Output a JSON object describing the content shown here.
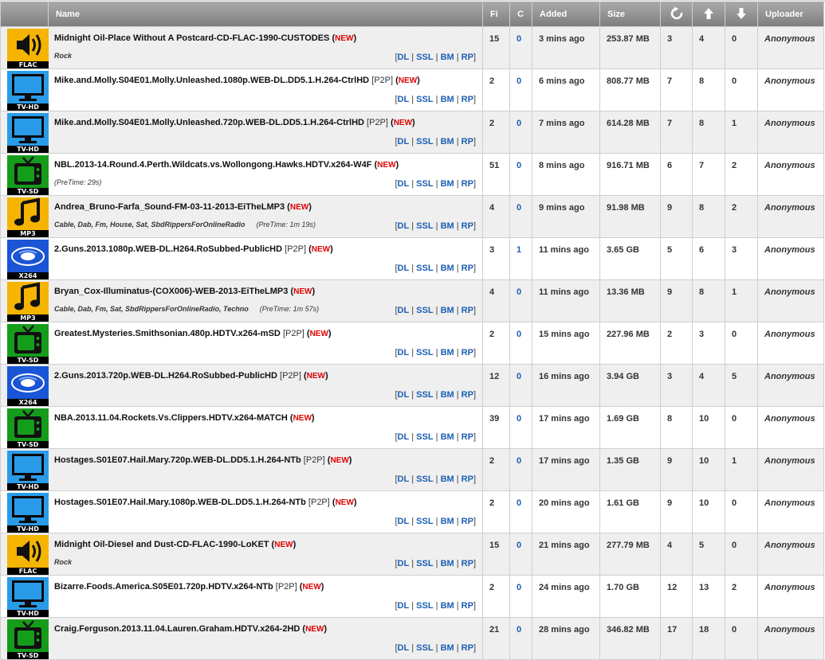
{
  "headers": {
    "name": "Name",
    "files": "Fi",
    "comments": "C",
    "added": "Added",
    "size": "Size",
    "uploader": "Uploader"
  },
  "category_icons": {
    "FLAC": "speaker-icon",
    "TV-HD": "monitor-icon",
    "TV-SD": "television-icon",
    "MP3": "music-note-icon",
    "X264": "bluray-disc-icon"
  },
  "link_labels": [
    "DL",
    "SSL",
    "BM",
    "RP"
  ],
  "new_label": "NEW",
  "torrents": [
    {
      "cat": "FLAC",
      "name": "Midnight Oil-Place Without A Postcard-CD-FLAC-1990-CUSTODES",
      "p2p": "",
      "tags": "Rock",
      "pretime": "",
      "files": "15",
      "comments": "0",
      "added": "3 mins ago",
      "size": "253.87 MB",
      "seeders": "3",
      "up": "4",
      "down": "0",
      "uploader": "Anonymous"
    },
    {
      "cat": "TV-HD",
      "name": "Mike.and.Molly.S04E01.Molly.Unleashed.1080p.WEB-DL.DD5.1.H.264-CtrlHD",
      "p2p": "[P2P]",
      "tags": "",
      "pretime": "",
      "files": "2",
      "comments": "0",
      "added": "6 mins ago",
      "size": "808.77 MB",
      "seeders": "7",
      "up": "8",
      "down": "0",
      "uploader": "Anonymous"
    },
    {
      "cat": "TV-HD",
      "name": "Mike.and.Molly.S04E01.Molly.Unleashed.720p.WEB-DL.DD5.1.H.264-CtrlHD",
      "p2p": "[P2P]",
      "tags": "",
      "pretime": "",
      "files": "2",
      "comments": "0",
      "added": "7 mins ago",
      "size": "614.28 MB",
      "seeders": "7",
      "up": "8",
      "down": "1",
      "uploader": "Anonymous"
    },
    {
      "cat": "TV-SD",
      "name": "NBL.2013-14.Round.4.Perth.Wildcats.vs.Wollongong.Hawks.HDTV.x264-W4F",
      "p2p": "",
      "tags": "",
      "pretime": "(PreTime: 29s)",
      "files": "51",
      "comments": "0",
      "added": "8 mins ago",
      "size": "916.71 MB",
      "seeders": "6",
      "up": "7",
      "down": "2",
      "uploader": "Anonymous"
    },
    {
      "cat": "MP3",
      "name": "Andrea_Bruno-Farfa_Sound-FM-03-11-2013-EiTheLMP3",
      "p2p": "",
      "tags": "Cable, Dab, Fm, House, Sat, SbdRippersForOnlineRadio",
      "pretime": "(PreTime: 1m 19s)",
      "files": "4",
      "comments": "0",
      "added": "9 mins ago",
      "size": "91.98 MB",
      "seeders": "9",
      "up": "8",
      "down": "2",
      "uploader": "Anonymous"
    },
    {
      "cat": "X264",
      "name": "2.Guns.2013.1080p.WEB-DL.H264.RoSubbed-PublicHD",
      "p2p": "[P2P]",
      "tags": "",
      "pretime": "",
      "files": "3",
      "comments": "1",
      "added": "11 mins ago",
      "size": "3.65 GB",
      "seeders": "5",
      "up": "6",
      "down": "3",
      "uploader": "Anonymous"
    },
    {
      "cat": "MP3",
      "name": "Bryan_Cox-Illuminatus-(COX006)-WEB-2013-EiTheLMP3",
      "p2p": "",
      "tags": "Cable, Dab, Fm, Sat, SbdRippersForOnlineRadio, Techno",
      "pretime": "(PreTime: 1m 57s)",
      "files": "4",
      "comments": "0",
      "added": "11 mins ago",
      "size": "13.36 MB",
      "seeders": "9",
      "up": "8",
      "down": "1",
      "uploader": "Anonymous"
    },
    {
      "cat": "TV-SD",
      "name": "Greatest.Mysteries.Smithsonian.480p.HDTV.x264-mSD",
      "p2p": "[P2P]",
      "tags": "",
      "pretime": "",
      "files": "2",
      "comments": "0",
      "added": "15 mins ago",
      "size": "227.96 MB",
      "seeders": "2",
      "up": "3",
      "down": "0",
      "uploader": "Anonymous"
    },
    {
      "cat": "X264",
      "name": "2.Guns.2013.720p.WEB-DL.H264.RoSubbed-PublicHD",
      "p2p": "[P2P]",
      "tags": "",
      "pretime": "",
      "files": "12",
      "comments": "0",
      "added": "16 mins ago",
      "size": "3.94 GB",
      "seeders": "3",
      "up": "4",
      "down": "5",
      "uploader": "Anonymous"
    },
    {
      "cat": "TV-SD",
      "name": "NBA.2013.11.04.Rockets.Vs.Clippers.HDTV.x264-MATCH",
      "p2p": "",
      "tags": "",
      "pretime": "",
      "files": "39",
      "comments": "0",
      "added": "17 mins ago",
      "size": "1.69 GB",
      "seeders": "8",
      "up": "10",
      "down": "0",
      "uploader": "Anonymous"
    },
    {
      "cat": "TV-HD",
      "name": "Hostages.S01E07.Hail.Mary.720p.WEB-DL.DD5.1.H.264-NTb",
      "p2p": "[P2P]",
      "tags": "",
      "pretime": "",
      "files": "2",
      "comments": "0",
      "added": "17 mins ago",
      "size": "1.35 GB",
      "seeders": "9",
      "up": "10",
      "down": "1",
      "uploader": "Anonymous"
    },
    {
      "cat": "TV-HD",
      "name": "Hostages.S01E07.Hail.Mary.1080p.WEB-DL.DD5.1.H.264-NTb",
      "p2p": "[P2P]",
      "tags": "",
      "pretime": "",
      "files": "2",
      "comments": "0",
      "added": "20 mins ago",
      "size": "1.61 GB",
      "seeders": "9",
      "up": "10",
      "down": "0",
      "uploader": "Anonymous"
    },
    {
      "cat": "FLAC",
      "name": "Midnight Oil-Diesel and Dust-CD-FLAC-1990-LoKET",
      "p2p": "",
      "tags": "Rock",
      "pretime": "",
      "files": "15",
      "comments": "0",
      "added": "21 mins ago",
      "size": "277.79 MB",
      "seeders": "4",
      "up": "5",
      "down": "0",
      "uploader": "Anonymous"
    },
    {
      "cat": "TV-HD",
      "name": "Bizarre.Foods.America.S05E01.720p.HDTV.x264-NTb",
      "p2p": "[P2P]",
      "tags": "",
      "pretime": "",
      "files": "2",
      "comments": "0",
      "added": "24 mins ago",
      "size": "1.70 GB",
      "seeders": "12",
      "up": "13",
      "down": "2",
      "uploader": "Anonymous"
    },
    {
      "cat": "TV-SD",
      "name": "Craig.Ferguson.2013.11.04.Lauren.Graham.HDTV.x264-2HD",
      "p2p": "",
      "tags": "",
      "pretime": "",
      "files": "21",
      "comments": "0",
      "added": "28 mins ago",
      "size": "346.82 MB",
      "seeders": "17",
      "up": "18",
      "down": "0",
      "uploader": "Anonymous"
    }
  ]
}
